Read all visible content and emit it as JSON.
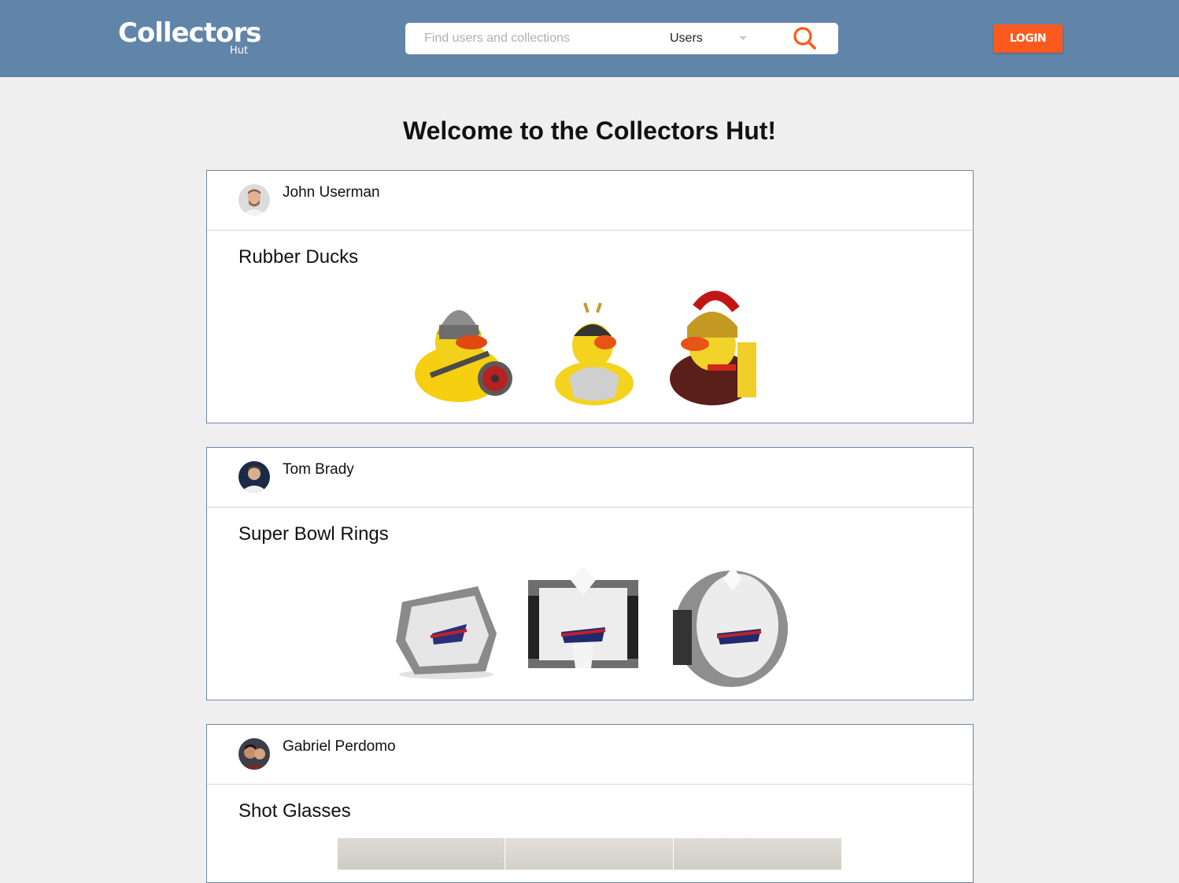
{
  "header": {
    "logo": "Collectors",
    "logo_sub": "Hut",
    "search": {
      "placeholder": "Find users and collections",
      "value": "",
      "filter_selected": "Users"
    },
    "login_label": "LOGIN",
    "colors": {
      "bar": "#6184a9",
      "accent": "#fb5a1e"
    }
  },
  "main": {
    "title": "Welcome to the Collectors Hut!",
    "feed": [
      {
        "user": "John Userman",
        "collection": "Rubber Ducks",
        "items": [
          "viking-rubber-duck",
          "samurai-rubber-duck",
          "roman-soldier-rubber-duck"
        ]
      },
      {
        "user": "Tom Brady",
        "collection": "Super Bowl Rings",
        "items": [
          "super-bowl-ring-1",
          "super-bowl-ring-2",
          "super-bowl-ring-3"
        ]
      },
      {
        "user": "Gabriel Perdomo",
        "collection": "Shot Glasses",
        "items": [
          "shot-glass-1",
          "shot-glass-2",
          "shot-glass-3"
        ]
      }
    ]
  }
}
